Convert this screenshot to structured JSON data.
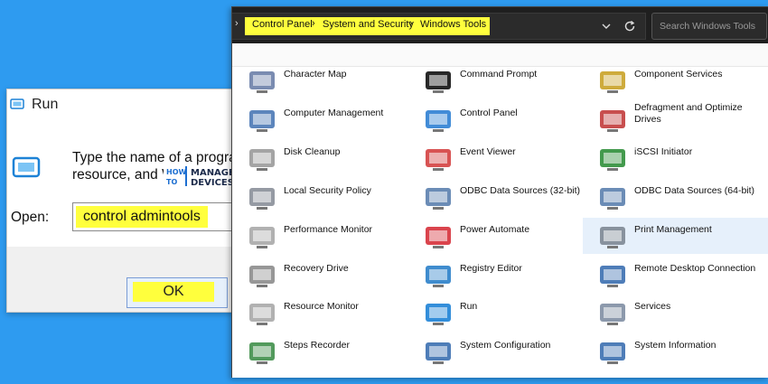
{
  "run_dialog": {
    "title": "Run",
    "description": "Type the name of a progra\nresource, and Wi",
    "open_label": "Open:",
    "input_value": "control admintools",
    "ok_label": "OK"
  },
  "logo": {
    "text_how": "HOW",
    "text_to": "TO",
    "text_manage": "MANAGE",
    "text_devices": "DEVICES"
  },
  "explorer": {
    "breadcrumbs": [
      "Control Panel",
      "System and Security",
      "Windows Tools"
    ],
    "search_placeholder": "Search Windows Tools",
    "highlight_color": "#ffff3d",
    "tools": [
      {
        "label": "Character Map",
        "icon": "character-map-icon"
      },
      {
        "label": "Command Prompt",
        "icon": "command-prompt-icon"
      },
      {
        "label": "Component Services",
        "icon": "component-services-icon"
      },
      {
        "label": "Computer Management",
        "icon": "computer-management-icon"
      },
      {
        "label": "Control Panel",
        "icon": "control-panel-icon"
      },
      {
        "label": "Defragment and Optimize\nDrives",
        "icon": "defragment-icon"
      },
      {
        "label": "Disk Cleanup",
        "icon": "disk-cleanup-icon"
      },
      {
        "label": "Event Viewer",
        "icon": "event-viewer-icon"
      },
      {
        "label": "iSCSI Initiator",
        "icon": "iscsi-initiator-icon"
      },
      {
        "label": "Local Security Policy",
        "icon": "local-security-policy-icon"
      },
      {
        "label": "ODBC Data Sources (32-bit)",
        "icon": "odbc-32-icon"
      },
      {
        "label": "ODBC Data Sources (64-bit)",
        "icon": "odbc-64-icon"
      },
      {
        "label": "Performance Monitor",
        "icon": "performance-monitor-icon"
      },
      {
        "label": "Power Automate",
        "icon": "power-automate-icon"
      },
      {
        "label": "Print Management",
        "icon": "print-management-icon",
        "selected": true
      },
      {
        "label": "Recovery Drive",
        "icon": "recovery-drive-icon"
      },
      {
        "label": "Registry Editor",
        "icon": "registry-editor-icon"
      },
      {
        "label": "Remote Desktop Connection",
        "icon": "remote-desktop-icon"
      },
      {
        "label": "Resource Monitor",
        "icon": "resource-monitor-icon"
      },
      {
        "label": "Run",
        "icon": "run-icon"
      },
      {
        "label": "Services",
        "icon": "services-icon"
      },
      {
        "label": "Steps Recorder",
        "icon": "steps-recorder-icon"
      },
      {
        "label": "System Configuration",
        "icon": "system-configuration-icon"
      },
      {
        "label": "System Information",
        "icon": "system-information-icon"
      }
    ]
  }
}
